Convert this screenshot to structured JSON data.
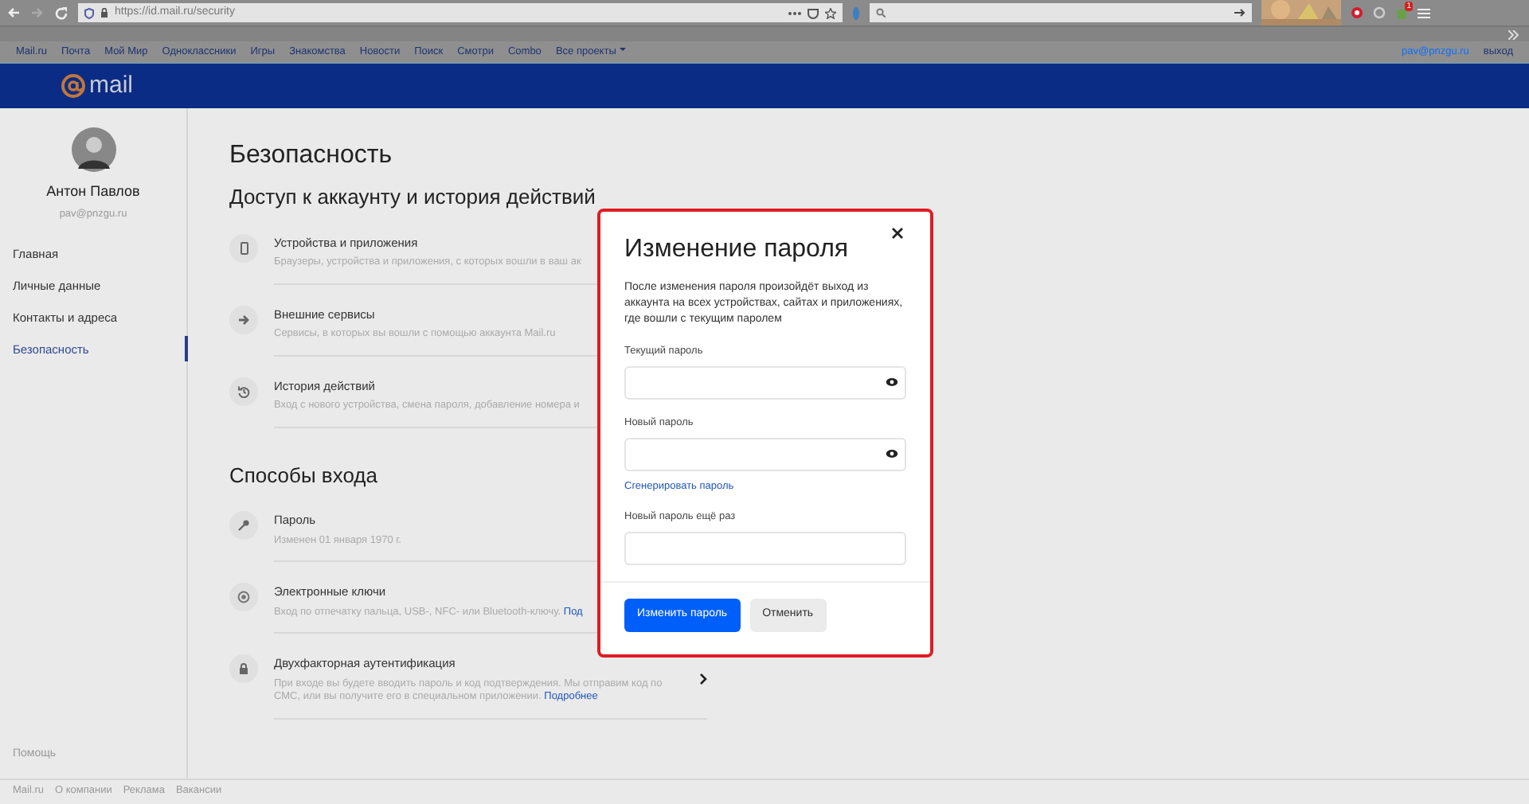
{
  "browser": {
    "url": "https://id.mail.ru/security",
    "extension_badge": "1"
  },
  "portal_nav": {
    "links": [
      "Mail.ru",
      "Почта",
      "Мой Мир",
      "Одноклассники",
      "Игры",
      "Знакомства",
      "Новости",
      "Поиск",
      "Смотри",
      "Combo",
      "Все проекты"
    ],
    "user": "pav@pnzgu.ru",
    "logout": "выход"
  },
  "header": {
    "logo": "mail"
  },
  "sidebar": {
    "name": "Антон Павлов",
    "email": "pav@pnzgu.ru",
    "items": [
      {
        "label": "Главная",
        "selected": false
      },
      {
        "label": "Личные данные",
        "selected": false
      },
      {
        "label": "Контакты и адреса",
        "selected": false
      },
      {
        "label": "Безопасность",
        "selected": true
      }
    ],
    "help": "Помощь"
  },
  "main": {
    "title": "Безопасность",
    "sections": [
      {
        "title": "Доступ к аккаунту и история действий",
        "items": [
          {
            "title": "Устройства и приложения",
            "description": "Браузеры, устройства и приложения, с которых вошли в ваш ак"
          },
          {
            "title": "Внешние сервисы",
            "description": "Сервисы, в которых вы вошли с помощью аккаунта Mail.ru"
          },
          {
            "title": "История действий",
            "description": "Вход с нового устройства, смена пароля, добавление номера и"
          }
        ]
      },
      {
        "title": "Способы входа",
        "items": [
          {
            "title": "Пароль",
            "description": "Изменен 01 января 1970 г."
          },
          {
            "title": "Электронные ключи",
            "description": "Вход по отпечатку пальца, USB-, NFC- или Bluetooth-ключу.",
            "link": "Под"
          },
          {
            "title": "Двухфакторная аутентификация",
            "description": "При входе вы будете вводить пароль и код подтверждения. Мы отправим код по СМС, или вы получите его в специальном приложении.",
            "link": "Подробнее",
            "chevron": true
          }
        ]
      }
    ]
  },
  "footer": {
    "links": [
      "Mail.ru",
      "О компании",
      "Реклама",
      "Вакансии"
    ]
  },
  "modal": {
    "title": "Изменение пароля",
    "text": "После изменения пароля произойдёт выход из аккаунта на всех устройствах, сайтах и приложениях, где вошли с текущим паролем",
    "fields": [
      {
        "label": "Текущий пароль",
        "kind": "password"
      },
      {
        "label": "Новый пароль",
        "kind": "password",
        "link": "Сгенерировать пароль"
      },
      {
        "label": "Новый пароль ещё раз",
        "kind": "plain"
      }
    ],
    "buttons": [
      {
        "label": "Изменить пароль",
        "kind": "primary"
      },
      {
        "label": "Отменить",
        "kind": "secondary"
      }
    ]
  }
}
